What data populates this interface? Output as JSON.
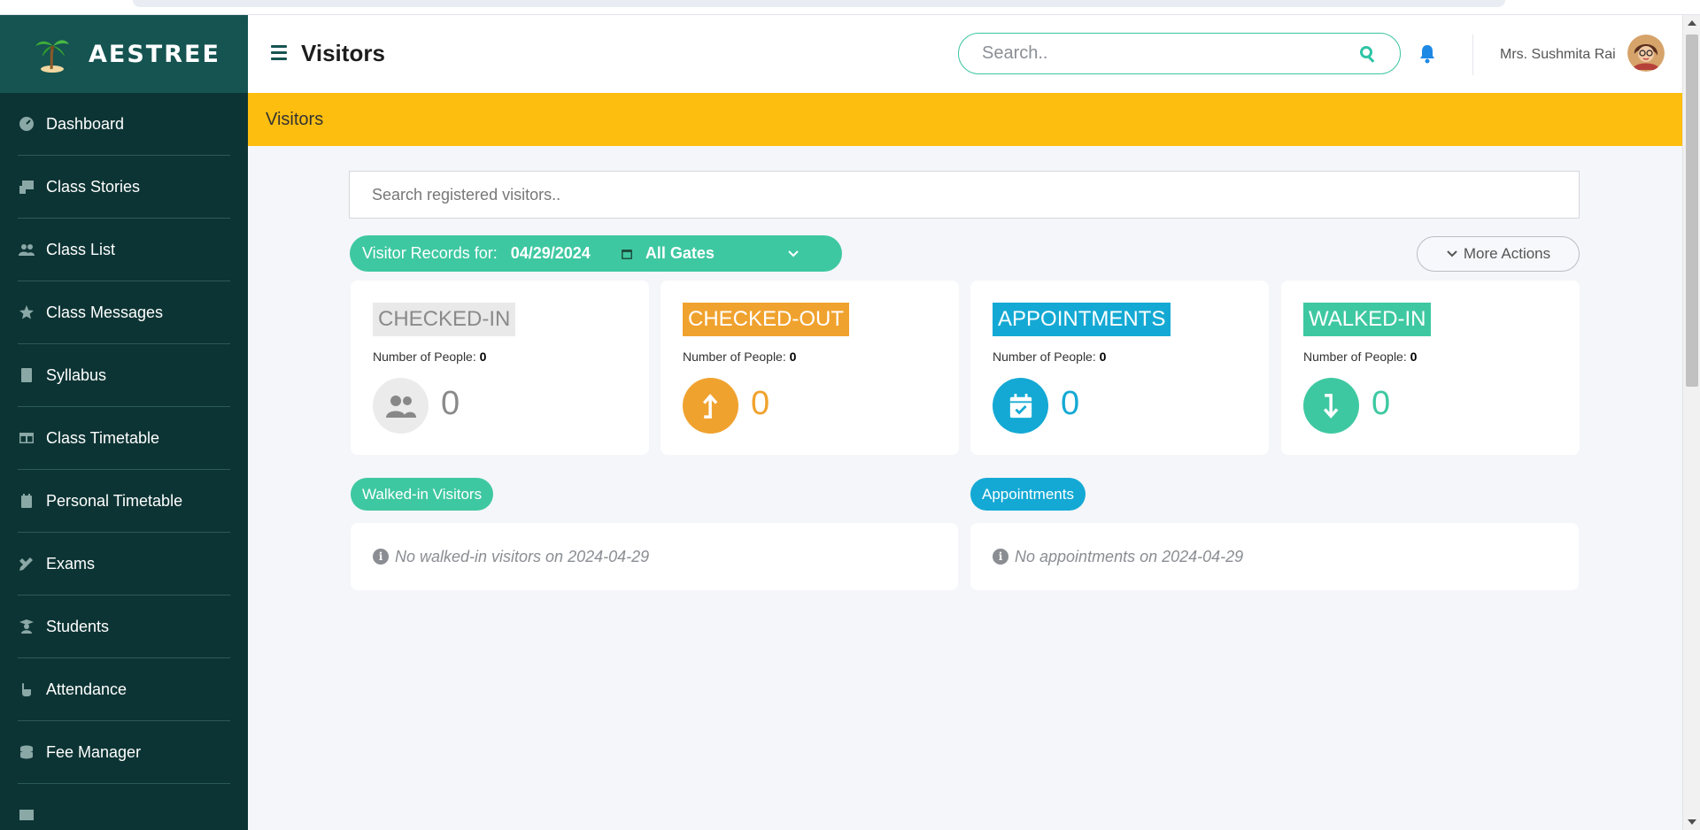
{
  "brand": {
    "name": "AESTREE"
  },
  "sidebar": {
    "items": [
      {
        "label": "Dashboard",
        "icon": "dashboard-icon"
      },
      {
        "label": "Class Stories",
        "icon": "class-stories-icon"
      },
      {
        "label": "Class List",
        "icon": "users-icon"
      },
      {
        "label": "Class Messages",
        "icon": "star-icon"
      },
      {
        "label": "Syllabus",
        "icon": "book-icon"
      },
      {
        "label": "Class Timetable",
        "icon": "table-icon"
      },
      {
        "label": "Personal Timetable",
        "icon": "calendar-icon"
      },
      {
        "label": "Exams",
        "icon": "pencil-ruler-icon"
      },
      {
        "label": "Students",
        "icon": "student-icon"
      },
      {
        "label": "Attendance",
        "icon": "hand-icon"
      },
      {
        "label": "Fee Manager",
        "icon": "coins-icon"
      }
    ]
  },
  "header": {
    "title": "Visitors",
    "search_placeholder": "Search..",
    "user_name": "Mrs. Sushmita Rai"
  },
  "banner": {
    "title": "Visitors"
  },
  "main": {
    "visitor_search_placeholder": "Search registered visitors..",
    "records_label": "Visitor Records for:",
    "records_date": "04/29/2024",
    "gate_selected": "All Gates",
    "more_actions": "More Actions",
    "people_label": "Number of People:",
    "cards": [
      {
        "tag": "CHECKED-IN",
        "people": "0",
        "count": "0",
        "color": "#e9e9e9",
        "text_color": "#8a8a8a",
        "icon": "users-icon"
      },
      {
        "tag": "CHECKED-OUT",
        "people": "0",
        "count": "0",
        "color": "#f0a22e",
        "text_color": "#f0a22e",
        "icon": "arrow-up-icon"
      },
      {
        "tag": "APPOINTMENTS",
        "people": "0",
        "count": "0",
        "color": "#14a9d4",
        "text_color": "#14a9d4",
        "icon": "calendar-check-icon"
      },
      {
        "tag": "WALKED-IN",
        "people": "0",
        "count": "0",
        "color": "#3ec8a1",
        "text_color": "#3ec8a1",
        "icon": "arrow-down-icon"
      }
    ],
    "walked_in_title": "Walked-in Visitors",
    "walked_in_empty": "No walked-in visitors on 2024-04-29",
    "appointments_title": "Appointments",
    "appointments_empty": "No appointments on 2024-04-29"
  },
  "colors": {
    "sidebar": "#0d3434",
    "brand_bar": "#155451",
    "banner": "#fdbe10",
    "accent": "#3ec8a1"
  }
}
